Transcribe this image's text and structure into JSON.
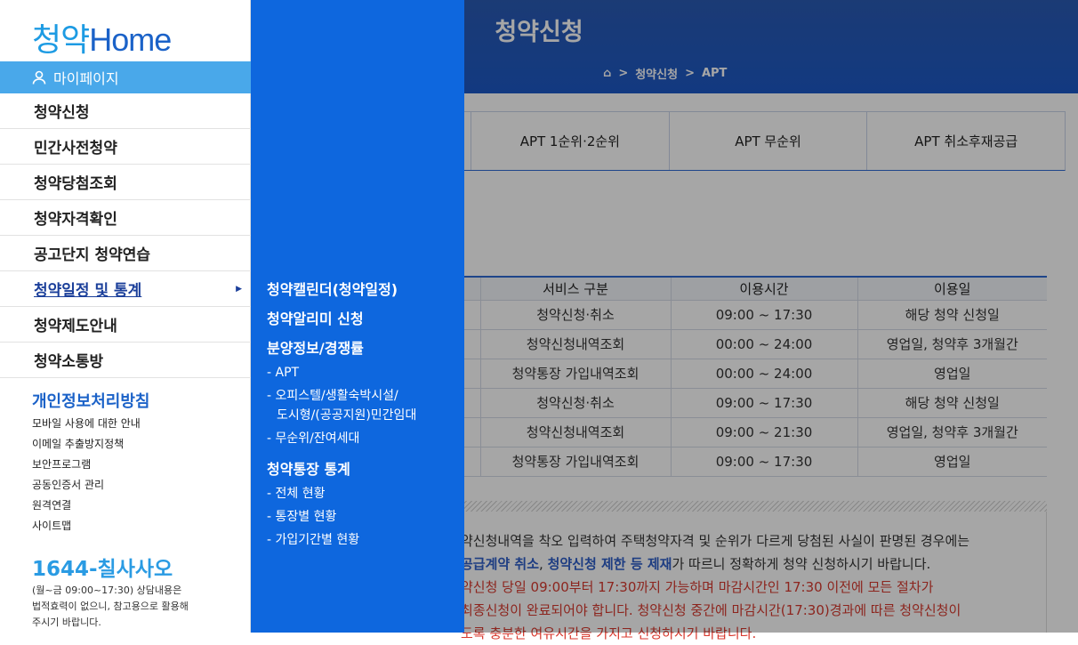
{
  "page": {
    "title": "청약신청",
    "breadcrumb": [
      "청약신청",
      "APT"
    ]
  },
  "tabs": [
    "",
    "APT 1순위·2순위",
    "APT 무순위",
    "APT 취소후재공급"
  ],
  "table": {
    "headers": [
      "",
      "서비스 구분",
      "이용시간",
      "이용일"
    ],
    "rows": [
      [
        "",
        "청약신청·취소",
        "09:00 ~ 17:30",
        "해당 청약 신청일"
      ],
      [
        "",
        "청약신청내역조회",
        "00:00 ~ 24:00",
        "영업일, 청약후 3개월간"
      ],
      [
        "",
        "청약통장 가입내역조회",
        "00:00 ~ 24:00",
        "영업일"
      ],
      [
        "",
        "청약신청·취소",
        "09:00 ~ 17:30",
        "해당 청약 신청일"
      ],
      [
        "",
        "청약신청내역조회",
        "09:00 ~ 21:30",
        "영업일, 청약후 3개월간"
      ],
      [
        "",
        "청약통장 가입내역조회",
        "09:00 ~ 17:30",
        "영업일"
      ]
    ]
  },
  "notice": {
    "line1": "약신청내역을 착오 입력하여 주택청약자격 및 순위가 다르게 당첨된 사실이 판명된 경우에는",
    "line2a": "공급계약 취소",
    "line2b": ", ",
    "line2c": "청약신청 제한 등 제재",
    "line2d": "가 따르니 정확하게 청약 신청하시기 바랍니다.",
    "line3": "약신청 당일 09:00부터 17:30까지 가능하며 마감시간인 17:30 이전에 모든 절차가",
    "line4": "최종신청이 완료되어야 합니다. 청약신청 중간에 마감시간(17:30)경과에 따른 청약신청이",
    "line5": "도록 충분한 여유시간을 가지고 신청하시기 바랍니다."
  },
  "sidebar": {
    "logo_main": "청약",
    "logo_sub": "Home",
    "mypage": "마이페이지",
    "menu": [
      "청약신청",
      "민간사전청약",
      "청약당첨조회",
      "청약자격확인",
      "공고단지 청약연습",
      "청약일정 및 통계",
      "청약제도안내",
      "청약소통방"
    ],
    "privacy": "개인정보처리방침",
    "links": [
      "모바일 사용에 대한 안내",
      "이메일 추출방지정책",
      "보안프로그램",
      "공동인증서 관리",
      "원격연결",
      "사이트맵"
    ],
    "phone": "1644-칠사사오",
    "notes": [
      "(월~금 09:00~17:30) 상담내용은",
      "법적효력이 없으니, 참고용으로 활용해",
      "주시기 바랍니다."
    ]
  },
  "flyout": {
    "h1": "청약캘린더(청약일정)",
    "h2": "청약알리미 신청",
    "h3": "분양정보/경쟁률",
    "s1": "- APT",
    "s2a": "- 오피스텔/생활숙박시설/",
    "s2b": "도시형/(공공지원)민간임대",
    "s3": "- 무순위/잔여세대",
    "h4": "청약통장 통계",
    "s4": "- 전체 현황",
    "s5": "- 통장별 현황",
    "s6": "- 가입기간별 현황"
  }
}
